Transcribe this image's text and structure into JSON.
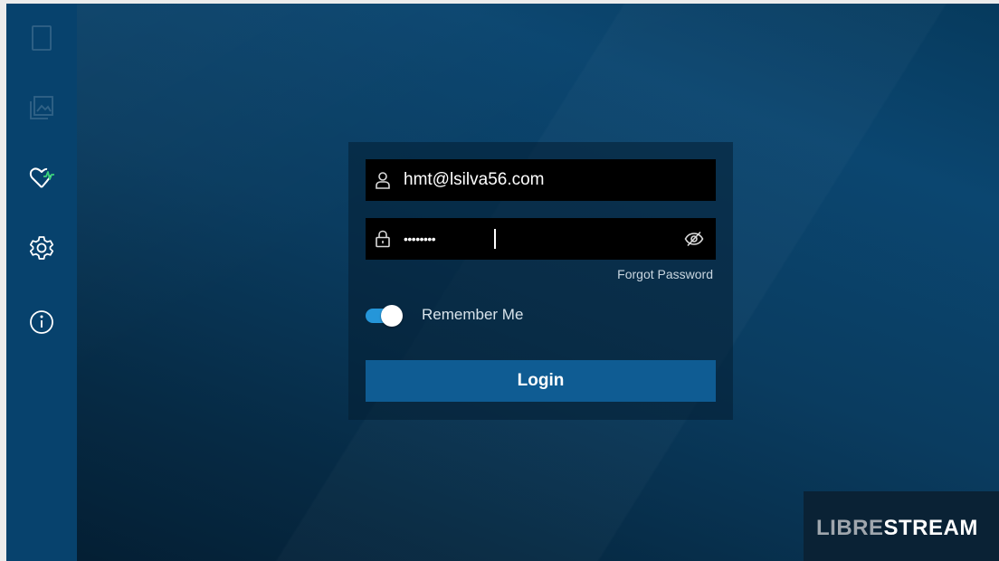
{
  "sidebar": {
    "items": [
      {
        "name": "document-icon",
        "enabled": false
      },
      {
        "name": "gallery-icon",
        "enabled": false
      },
      {
        "name": "health-heart-icon",
        "enabled": true
      },
      {
        "name": "settings-gear-icon",
        "enabled": true
      },
      {
        "name": "info-icon",
        "enabled": true
      }
    ]
  },
  "login": {
    "username": {
      "value": "hmt@lsilva56.com",
      "icon": "user-icon"
    },
    "password": {
      "value": "********",
      "icon": "lock-icon",
      "visibility_icon": "eye-hidden-icon"
    },
    "forgot_password": "Forgot Password",
    "remember_me": {
      "label": "Remember Me",
      "checked": true
    },
    "login_button": "Login"
  },
  "brand": {
    "logo_part1": "LIBRE",
    "logo_part2": "STREAM"
  },
  "colors": {
    "sidebar": "#07426d",
    "toggle_accent": "#2596d9",
    "button": "#0f5c93",
    "field_bg": "#000000"
  }
}
